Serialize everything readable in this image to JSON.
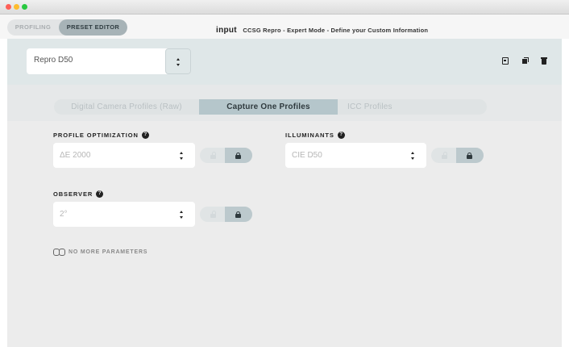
{
  "header": {
    "modes": [
      "PROFILING",
      "PRESET EDITOR"
    ],
    "active_mode": "PRESET EDITOR",
    "title_main": "input",
    "title_sub": "CCSG Repro - Expert Mode - Define your Custom Information"
  },
  "preset": {
    "selected": "Repro D50"
  },
  "toolbar": {
    "icons": [
      "save-icon",
      "duplicate-icon",
      "delete-icon"
    ]
  },
  "tabs": [
    {
      "label": "Digital Camera Profiles (Raw)"
    },
    {
      "label": "Capture One Profiles"
    },
    {
      "label": "ICC Profiles"
    }
  ],
  "active_tab": "Capture One Profiles",
  "params": {
    "optimization": {
      "label": "PROFILE OPTIMIZATION",
      "help": "?",
      "value": "ΔE 2000",
      "locked": true
    },
    "illuminants": {
      "label": "ILLUMINANTS",
      "help": "?",
      "value": "CIE D50",
      "locked": true
    },
    "observer": {
      "label": "OBSERVER",
      "help": "?",
      "value": "2°",
      "locked": true
    }
  },
  "no_more": "NO MORE PARAMETERS",
  "colors": {
    "accent": "#b5c6cb",
    "preset_bar": "#dfe7e8",
    "panel": "#ececec"
  }
}
